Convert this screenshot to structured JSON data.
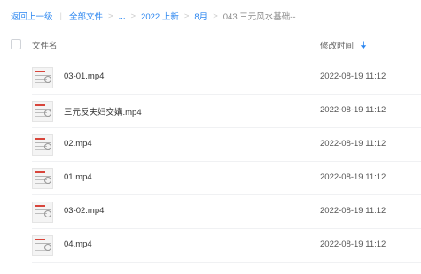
{
  "breadcrumb": {
    "back": "返回上一级",
    "all_files": "全部文件",
    "ellipsis": "...",
    "year": "2022 上新",
    "month": "8月",
    "current": "043.三元风水基础--..."
  },
  "header": {
    "name_label": "文件名",
    "time_label": "修改时间"
  },
  "accent_color": "#2b86f0",
  "files": [
    {
      "name": "03-01.mp4",
      "time": "2022-08-19 11:12"
    },
    {
      "name": "三元反夫妇交媾.mp4",
      "time": "2022-08-19 11:12"
    },
    {
      "name": "02.mp4",
      "time": "2022-08-19 11:12"
    },
    {
      "name": "01.mp4",
      "time": "2022-08-19 11:12"
    },
    {
      "name": "03-02.mp4",
      "time": "2022-08-19 11:12"
    },
    {
      "name": "04.mp4",
      "time": "2022-08-19 11:12"
    }
  ]
}
